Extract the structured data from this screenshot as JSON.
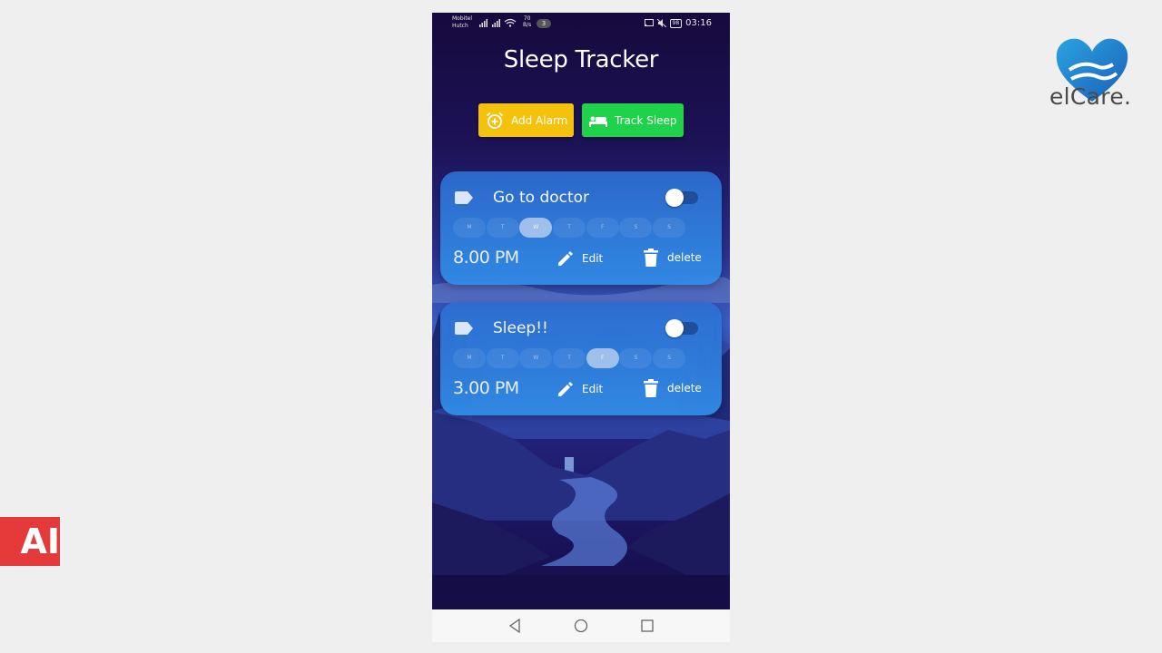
{
  "status_bar": {
    "carrier_line1": "Mobitel",
    "carrier_line2": "Hutch",
    "net_speed_value": "70",
    "net_speed_unit": "B/s",
    "notification_count": "3",
    "battery": "98",
    "time": "03:16"
  },
  "app": {
    "title": "Sleep Tracker",
    "add_alarm_label": "Add Alarm",
    "track_sleep_label": "Track Sleep",
    "colors": {
      "add_alarm": "#f4c20d",
      "track_sleep": "#1ed34a"
    }
  },
  "alarms": [
    {
      "title": "Go to doctor",
      "time": "8.00 PM",
      "enabled": false,
      "days": [
        "M",
        "T",
        "W",
        "T",
        "F",
        "S",
        "S"
      ],
      "active_day": "W",
      "edit_label": "Edit",
      "delete_label": "delete"
    },
    {
      "title": "Sleep!!",
      "time": "3.00 PM",
      "enabled": false,
      "days": [
        "M",
        "T",
        "W",
        "T",
        "F",
        "S",
        "S"
      ],
      "active_day": "F",
      "edit_label": "Edit",
      "delete_label": "delete"
    }
  ],
  "branding": {
    "elcare_text": "elCare.",
    "ai_logo_text": "AI"
  },
  "icons": [
    "add-alarm-icon",
    "bed-icon",
    "label-tag-icon",
    "pencil-icon",
    "trash-icon",
    "back-icon",
    "home-icon",
    "recents-icon"
  ]
}
